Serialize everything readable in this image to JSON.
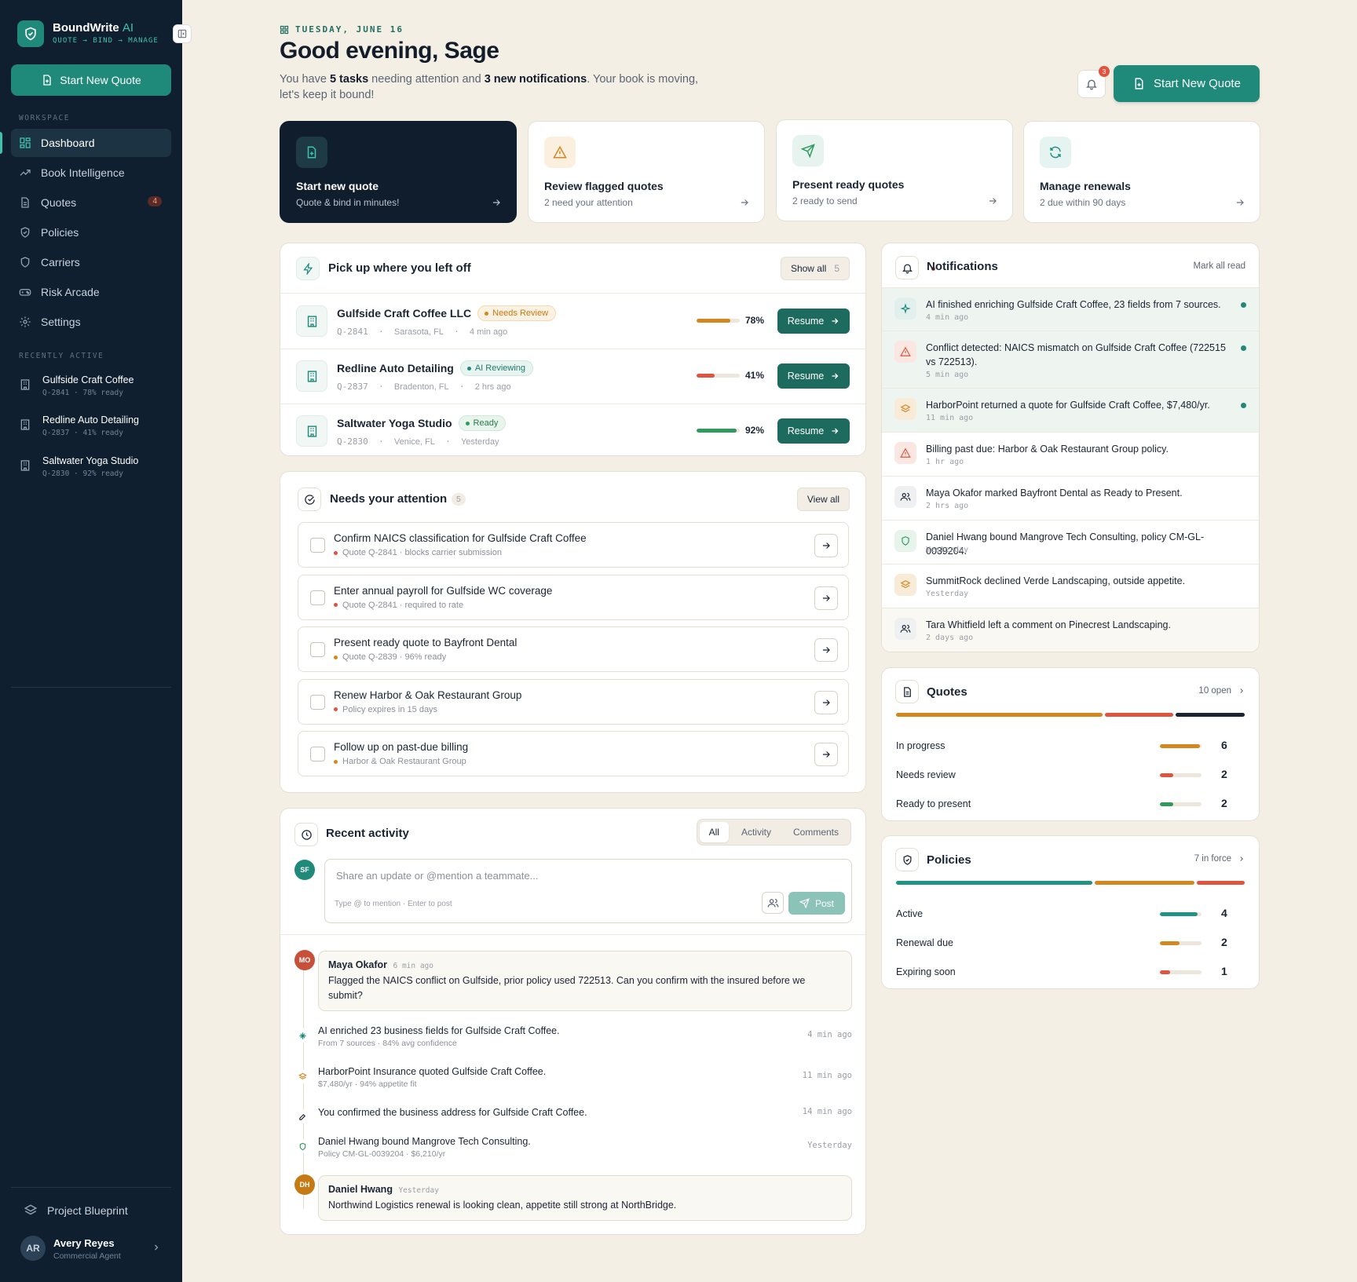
{
  "sidebar": {
    "brand": {
      "name": "BoundWrite",
      "suffix": "AI",
      "tagline": "QUOTE → BIND → MANAGE"
    },
    "new_quote": "Start New Quote",
    "workspace_label": "WORKSPACE",
    "nav": [
      {
        "label": "Dashboard",
        "icon": "dashboard-icon",
        "active": true
      },
      {
        "label": "Book Intelligence",
        "icon": "trend-icon"
      },
      {
        "label": "Quotes",
        "icon": "document-icon",
        "badge": "4"
      },
      {
        "label": "Policies",
        "icon": "shield-icon"
      },
      {
        "label": "Carriers",
        "icon": "shield-outline-icon"
      },
      {
        "label": "Risk Arcade",
        "icon": "gamepad-icon"
      },
      {
        "label": "Settings",
        "icon": "gear-icon"
      }
    ],
    "recent_label": "RECENTLY ACTIVE",
    "recent": [
      {
        "name": "Gulfside Craft Coffee",
        "meta": "Q-2841 · 78% ready"
      },
      {
        "name": "Redline Auto Detailing",
        "meta": "Q-2837 · 41% ready"
      },
      {
        "name": "Saltwater Yoga Studio",
        "meta": "Q-2830 · 92% ready"
      }
    ],
    "blueprint": "Project Blueprint",
    "user": {
      "initials": "AR",
      "name": "Avery Reyes",
      "role": "Commercial Agent"
    }
  },
  "header": {
    "date": "TUESDAY, JUNE 16",
    "greeting": "Good evening, Sage",
    "sub_a": "You have ",
    "tasks": "5 tasks",
    "sub_b": " needing attention and ",
    "notifications": "3 new notifications",
    "sub_c": ". Your book is moving, let's keep it bound!",
    "bell_count": "3",
    "new_quote": "Start New Quote"
  },
  "quick_actions": [
    {
      "title": "Start new quote",
      "sub": "Quote & bind in minutes!"
    },
    {
      "title": "Review flagged quotes",
      "sub": "2 need your attention"
    },
    {
      "title": "Present ready quotes",
      "sub": "2 ready to send"
    },
    {
      "title": "Manage renewals",
      "sub": "2 due within 90 days"
    }
  ],
  "pickup": {
    "title": "Pick up where you left off",
    "show_all": "Show all",
    "count": "5",
    "resume_label": "Resume",
    "items": [
      {
        "name": "Gulfside Craft Coffee LLC",
        "status": "Needs Review",
        "id": "Q-2841",
        "loc": "Sarasota, FL",
        "time": "4 min ago",
        "pct_label": "78%",
        "pct": 0.78,
        "color": "#d4861f"
      },
      {
        "name": "Redline Auto Detailing",
        "status": "AI Reviewing",
        "id": "Q-2837",
        "loc": "Bradenton, FL",
        "time": "2 hrs ago",
        "pct_label": "41%",
        "pct": 0.41,
        "color": "#e0533f"
      },
      {
        "name": "Saltwater Yoga Studio",
        "status": "Ready",
        "id": "Q-2830",
        "loc": "Venice, FL",
        "time": "Yesterday",
        "pct_label": "92%",
        "pct": 0.92,
        "color": "#2f9a5e"
      }
    ]
  },
  "attention": {
    "title": "Needs your attention",
    "count": "5",
    "view_all": "View all",
    "items": [
      {
        "title": "Confirm NAICS classification for Gulfside Craft Coffee",
        "sub": "Quote Q-2841 · blocks carrier submission",
        "dot": "#e0533f"
      },
      {
        "title": "Enter annual payroll for Gulfside WC coverage",
        "sub": "Quote Q-2841 · required to rate",
        "dot": "#e0533f"
      },
      {
        "title": "Present ready quote to Bayfront Dental",
        "sub": "Quote Q-2839 · 96% ready",
        "dot": "#d4861f"
      },
      {
        "title": "Renew Harbor & Oak Restaurant Group",
        "sub": "Policy expires in 15 days",
        "dot": "#e0533f"
      },
      {
        "title": "Follow up on past-due billing",
        "sub": "Harbor & Oak Restaurant Group",
        "dot": "#d4861f"
      }
    ]
  },
  "activity": {
    "title": "Recent activity",
    "tabs": [
      "All",
      "Activity",
      "Comments"
    ],
    "me_initials": "SF",
    "placeholder": "Share an update or @mention a teammate...",
    "hint": "Type @ to mention · Enter to post",
    "post": "Post",
    "comment1": {
      "initials": "MO",
      "name": "Maya Okafor",
      "time": "6 min ago",
      "text": "Flagged the NAICS conflict on Gulfside, prior policy used 722513. Can you confirm with the insured before we submit?"
    },
    "events": [
      {
        "text": "AI enriched 23 business fields for Gulfside Craft Coffee.",
        "sub": "From 7 sources · 84% avg confidence",
        "time": "4 min ago"
      },
      {
        "text": "HarborPoint Insurance quoted Gulfside Craft Coffee.",
        "sub": "$7,480/yr · 94% appetite fit",
        "time": "11 min ago"
      },
      {
        "text": "You confirmed the business address for Gulfside Craft Coffee.",
        "sub": "",
        "time": "14 min ago"
      },
      {
        "text": "Daniel Hwang bound Mangrove Tech Consulting.",
        "sub": "Policy CM-GL-0039204 · $6,210/yr",
        "time": "Yesterday"
      }
    ],
    "comment2": {
      "initials": "DH",
      "name": "Daniel Hwang",
      "time": "Yesterday",
      "text": "Northwind Logistics renewal is looking clean, appetite still strong at NorthBridge."
    }
  },
  "notifications": {
    "title": "Notifications",
    "mark_all": "Mark all read",
    "items": [
      {
        "text": "AI finished enriching Gulfside Craft Coffee, 23 fields from 7 sources.",
        "time": "4 min ago",
        "unread": true
      },
      {
        "text": "Conflict detected: NAICS mismatch on Gulfside Craft Coffee (722515 vs 722513).",
        "time": "5 min ago",
        "unread": true
      },
      {
        "text": "HarborPoint returned a quote for Gulfside Craft Coffee, $7,480/yr.",
        "time": "11 min ago",
        "unread": true
      },
      {
        "text": "Billing past due: Harbor & Oak Restaurant Group policy.",
        "time": "1 hr ago"
      },
      {
        "text": "Maya Okafor marked Bayfront Dental as Ready to Present.",
        "time": "2 hrs ago"
      },
      {
        "text": "Daniel Hwang bound Mangrove Tech Consulting, policy CM-GL-0039204.",
        "time": "Yesterday"
      },
      {
        "text": "SummitRock declined Verde Landscaping, outside appetite.",
        "time": "Yesterday"
      },
      {
        "text": "Tara Whitfield left a comment on Pinecrest Landscaping.",
        "time": "2 days ago"
      }
    ]
  },
  "quotes_panel": {
    "title": "Quotes",
    "open": "10 open",
    "rows": [
      {
        "label": "In progress",
        "value": "6",
        "share": 0.6,
        "color": "#d4861f"
      },
      {
        "label": "Needs review",
        "value": "2",
        "share": 0.2,
        "color": "#e0533f"
      },
      {
        "label": "Ready to present",
        "value": "2",
        "share": 0.2,
        "color": "#2f9a5e"
      }
    ]
  },
  "policies_panel": {
    "title": "Policies",
    "in_force": "7 in force",
    "rows": [
      {
        "label": "Active",
        "value": "4",
        "share": 0.57,
        "color": "#1f9483"
      },
      {
        "label": "Renewal due",
        "value": "2",
        "share": 0.29,
        "color": "#d4861f"
      },
      {
        "label": "Expiring soon",
        "value": "1",
        "share": 0.14,
        "color": "#e0533f"
      }
    ]
  }
}
